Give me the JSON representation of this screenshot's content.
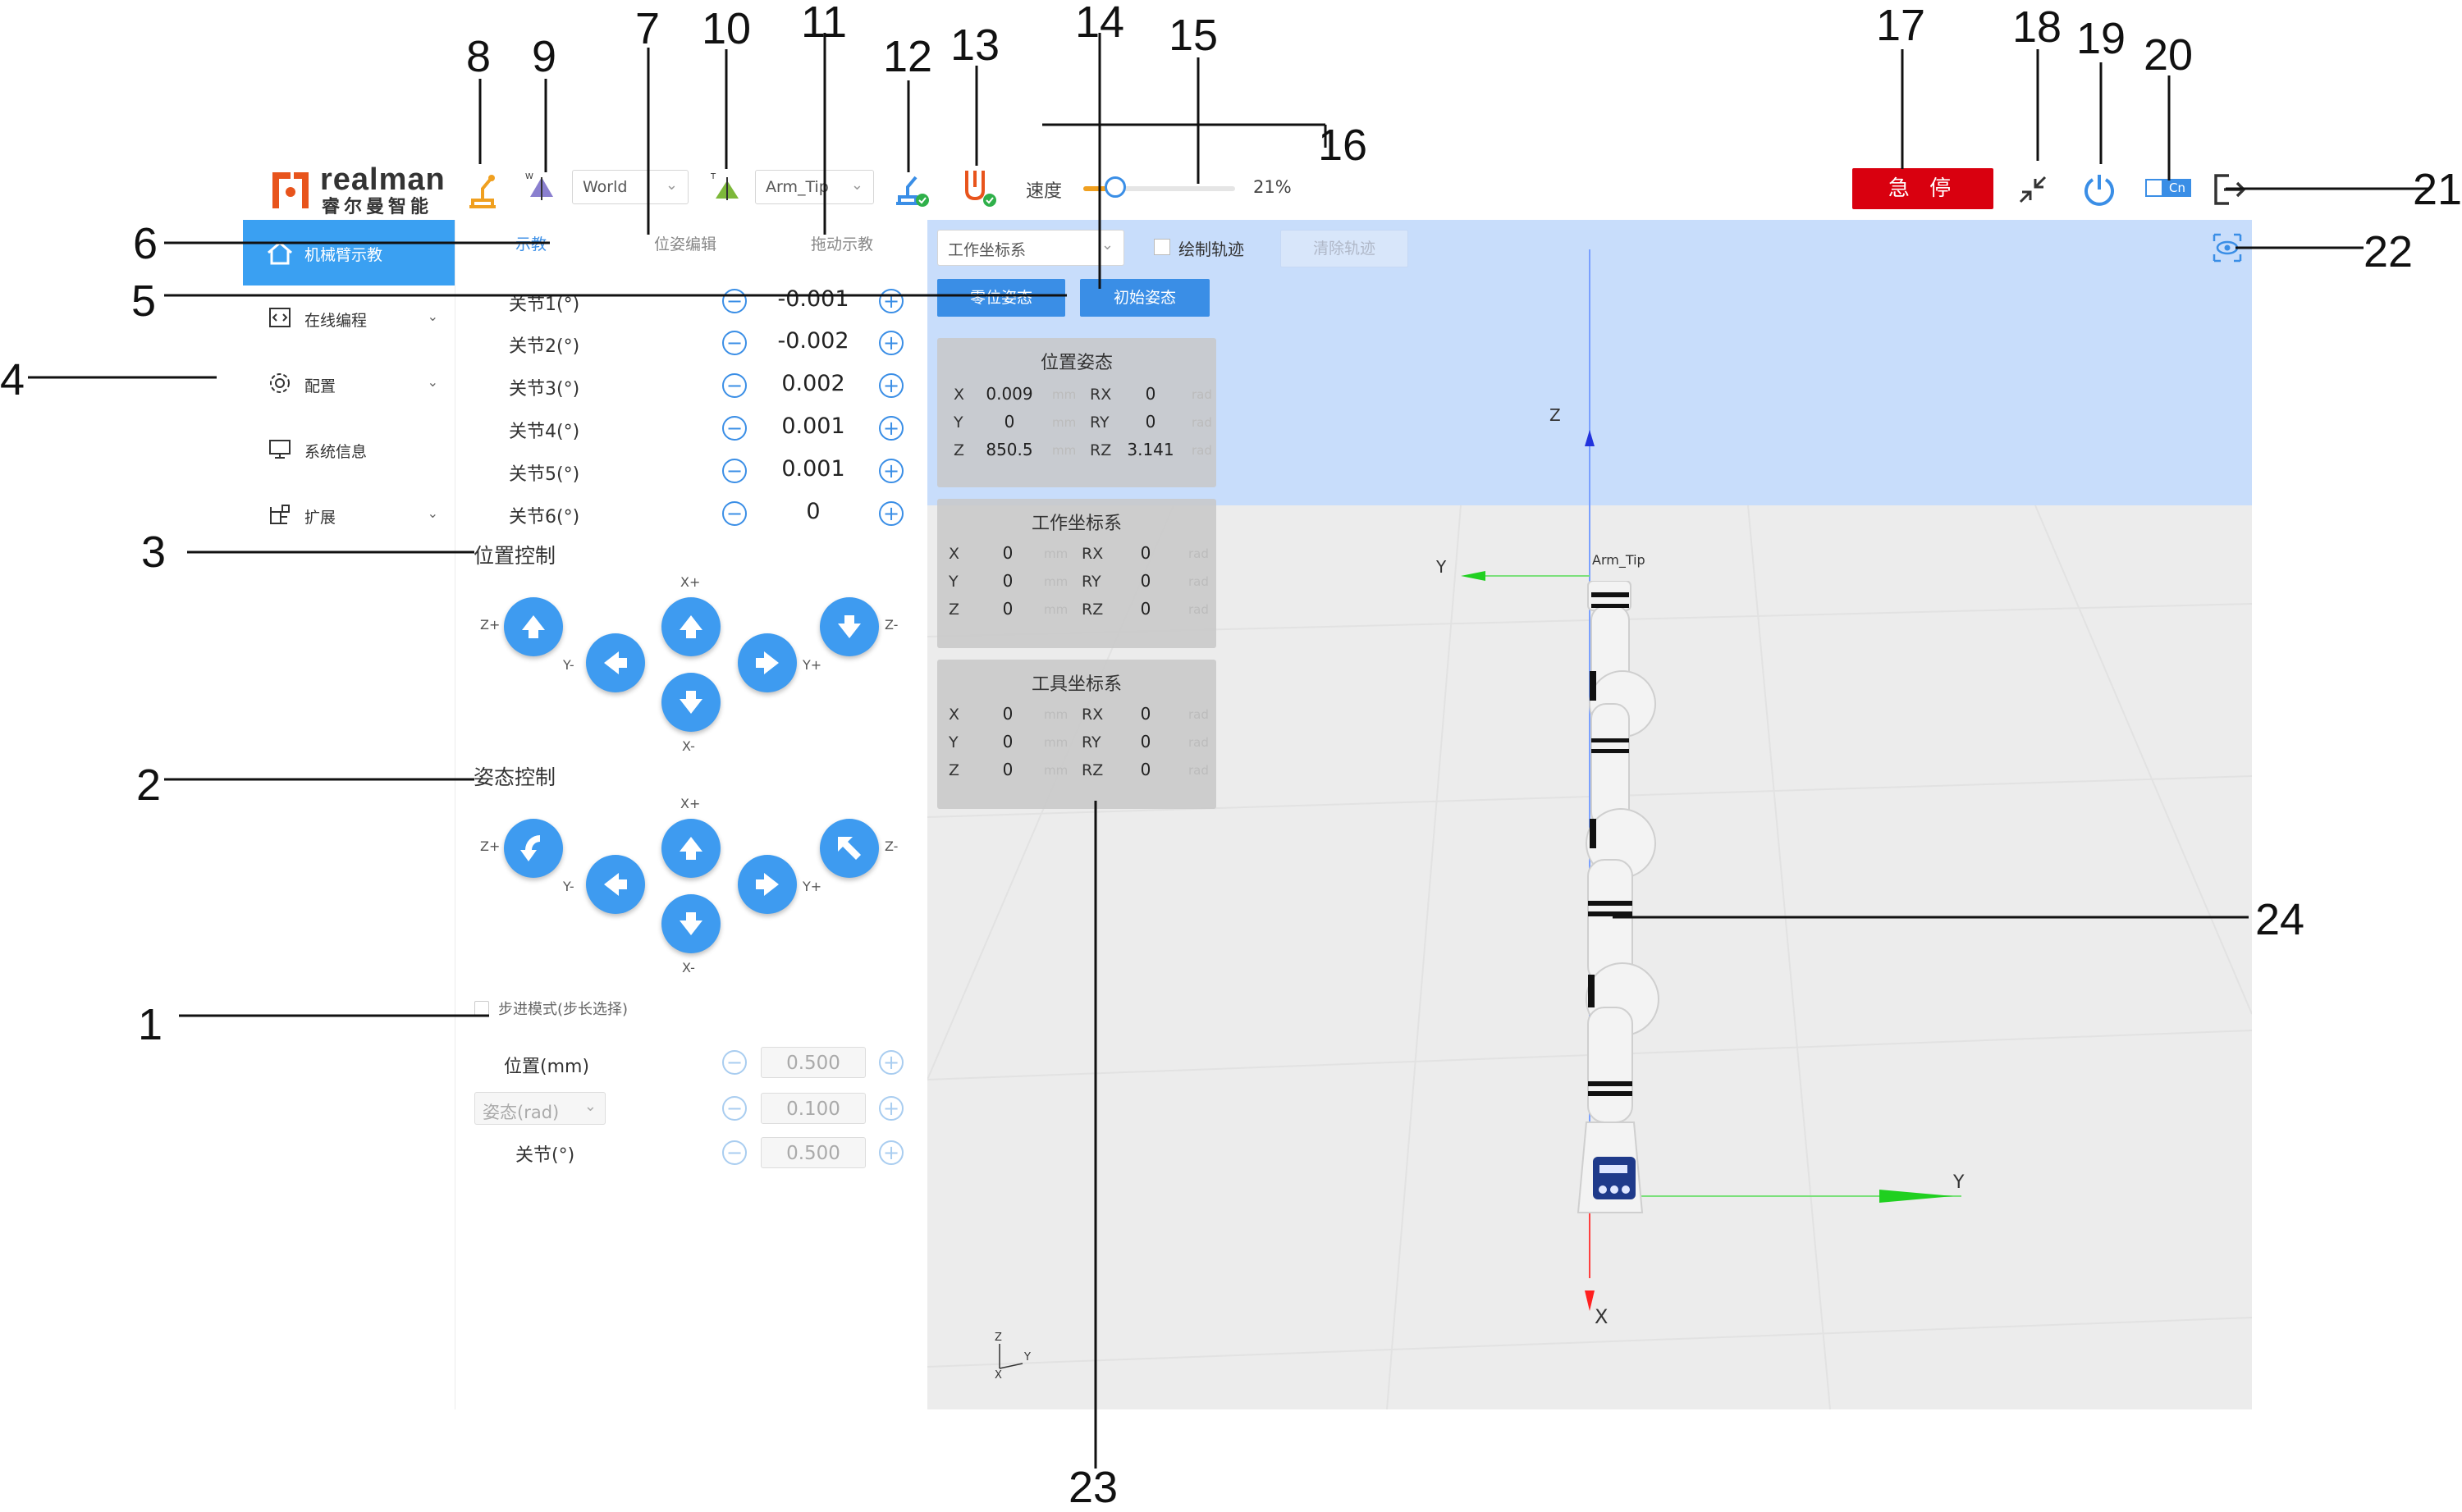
{
  "brand": {
    "name": "realman",
    "sub": "睿尔曼智能"
  },
  "header": {
    "frame_select": "World",
    "tool_select": "Arm_Tip",
    "speed_label": "速度",
    "speed_value": "21%",
    "speed_fraction": 0.21,
    "estop_label": "急 停",
    "lang_badge": "Cn"
  },
  "sidebar": {
    "items": [
      {
        "label": "机械臂示教",
        "icon": "home-icon"
      },
      {
        "label": "在线编程",
        "icon": "code-icon"
      },
      {
        "label": "配置",
        "icon": "gear-icon"
      },
      {
        "label": "系统信息",
        "icon": "monitor-icon"
      },
      {
        "label": "扩展",
        "icon": "extension-icon"
      }
    ]
  },
  "tabs": [
    "示教",
    "位姿编辑",
    "拖动示教"
  ],
  "joints": [
    {
      "label": "关节1(°)",
      "value": "-0.001"
    },
    {
      "label": "关节2(°)",
      "value": "-0.002"
    },
    {
      "label": "关节3(°)",
      "value": "0.002"
    },
    {
      "label": "关节4(°)",
      "value": "0.001"
    },
    {
      "label": "关节5(°)",
      "value": "0.001"
    },
    {
      "label": "关节6(°)",
      "value": "0"
    }
  ],
  "position_control": {
    "title": "位置控制",
    "labels": {
      "zp": "Z+",
      "zm": "Z-",
      "xp": "X+",
      "xm": "X-",
      "yp": "Y+",
      "ym": "Y-"
    }
  },
  "attitude_control": {
    "title": "姿态控制",
    "labels": {
      "zp": "Z+",
      "zm": "Z-",
      "xp": "X+",
      "xm": "X-",
      "yp": "Y+",
      "ym": "Y-"
    }
  },
  "step_mode": {
    "checkbox_label": "步进模式(步长选择)",
    "rows": [
      {
        "label": "位置(mm)",
        "value": "0.500"
      },
      {
        "label": "姿态(rad)",
        "value": "0.100"
      },
      {
        "label": "关节(°)",
        "value": "0.500"
      }
    ]
  },
  "viewport": {
    "coord_select": "工作坐标系",
    "draw_track_label": "绘制轨迹",
    "clear_track_label": "清除轨迹",
    "zero_pose_btn": "零位姿态",
    "init_pose_btn": "初始姿态",
    "axis_labels": {
      "z": "Z",
      "y": "Y",
      "x": "X"
    },
    "tip_label": "Arm_Tip",
    "panels": [
      {
        "title": "位置姿态",
        "rows": [
          {
            "a": "X",
            "av": "0.009",
            "au": "mm",
            "b": "RX",
            "bv": "0",
            "bu": "rad"
          },
          {
            "a": "Y",
            "av": "0",
            "au": "mm",
            "b": "RY",
            "bv": "0",
            "bu": "rad"
          },
          {
            "a": "Z",
            "av": "850.5",
            "au": "mm",
            "b": "RZ",
            "bv": "3.141",
            "bu": "rad"
          }
        ]
      },
      {
        "title": "工作坐标系",
        "rows": [
          {
            "a": "X",
            "av": "0",
            "au": "mm",
            "b": "RX",
            "bv": "0",
            "bu": "rad"
          },
          {
            "a": "Y",
            "av": "0",
            "au": "mm",
            "b": "RY",
            "bv": "0",
            "bu": "rad"
          },
          {
            "a": "Z",
            "av": "0",
            "au": "mm",
            "b": "RZ",
            "bv": "0",
            "bu": "rad"
          }
        ]
      },
      {
        "title": "工具坐标系",
        "rows": [
          {
            "a": "X",
            "av": "0",
            "au": "mm",
            "b": "RX",
            "bv": "0",
            "bu": "rad"
          },
          {
            "a": "Y",
            "av": "0",
            "au": "mm",
            "b": "RY",
            "bv": "0",
            "bu": "rad"
          },
          {
            "a": "Z",
            "av": "0",
            "au": "mm",
            "b": "RZ",
            "bv": "0",
            "bu": "rad"
          }
        ]
      }
    ]
  },
  "callouts": [
    "1",
    "2",
    "3",
    "4",
    "5",
    "6",
    "7",
    "8",
    "9",
    "10",
    "11",
    "12",
    "13",
    "14",
    "15",
    "16",
    "17",
    "18",
    "19",
    "20",
    "21",
    "22",
    "23",
    "24"
  ],
  "colors": {
    "accent": "#3a8ee6",
    "sidebar_active": "#3aa0f2",
    "estop": "#d9000f",
    "viewport_top": "#c8ddfb",
    "viewport": "#ececec"
  }
}
